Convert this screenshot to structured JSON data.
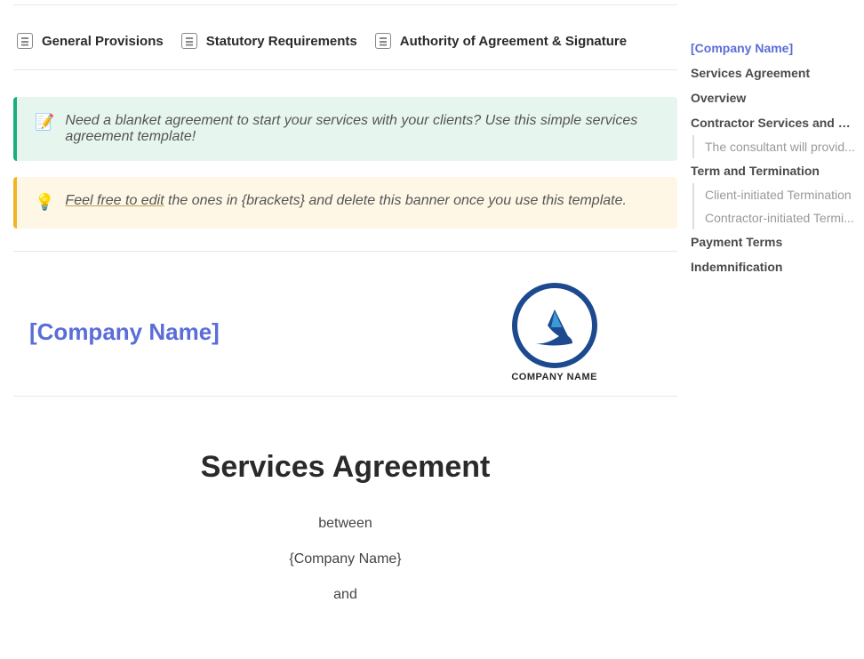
{
  "docLinks": {
    "generalProvisions": "General Provisions",
    "statutoryRequirements": "Statutory Requirements",
    "authority": "Authority of Agreement & Signature"
  },
  "callouts": {
    "intro": "Need a blanket agreement to start your services with your clients? Use this simple services agreement template!",
    "editUnderline": "Feel free to edit",
    "editRest": " the ones in {brackets} and delete this banner once you use this template."
  },
  "header": {
    "companyPlaceholder": "[Company Name]",
    "logoText": "COMPANY NAME"
  },
  "content": {
    "title": "Services Agreement",
    "between": "between",
    "companyName": "{Company Name}",
    "and": "and"
  },
  "toc": {
    "companyName": "[Company Name]",
    "servicesAgreement": "Services Agreement",
    "overview": "Overview",
    "contractorServices": "Contractor Services and Re...",
    "consultantProvide": "The consultant will provid...",
    "termTermination": "Term and Termination",
    "clientTermination": "Client-initiated Termination",
    "contractorTermination": "Contractor-initiated Termi...",
    "paymentTerms": "Payment Terms",
    "indemnification": "Indemnification"
  }
}
